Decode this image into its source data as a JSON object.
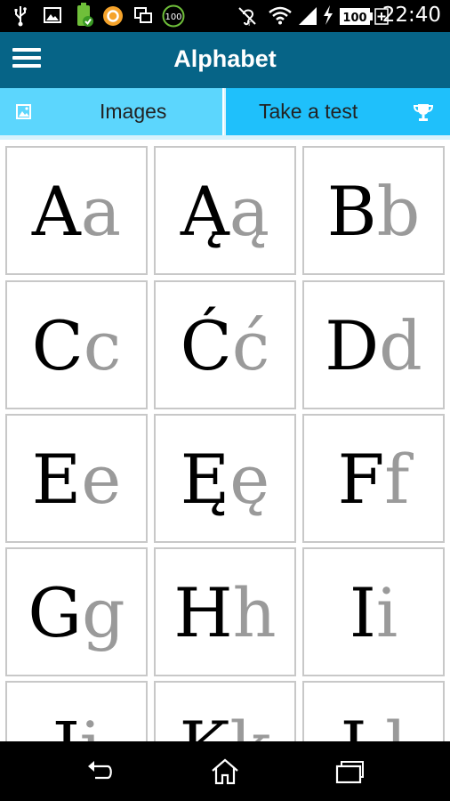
{
  "status_bar": {
    "time": "22:40",
    "battery_level": "100",
    "notification_badge": "100",
    "icons": [
      "usb-icon",
      "image-icon",
      "battery-app-icon",
      "orange-app-icon",
      "multiwindow-icon",
      "badge-100-icon",
      "hearing-icon",
      "wifi-icon",
      "signal-icon",
      "charging-icon",
      "battery-icon"
    ]
  },
  "app_bar": {
    "title": "Alphabet",
    "menu_icon": "hamburger-menu-icon"
  },
  "tabs": [
    {
      "label": "Images",
      "icon": "image-icon",
      "selected": true
    },
    {
      "label": "Take a test",
      "icon": "trophy-icon",
      "selected": false
    }
  ],
  "letters": [
    {
      "upper": "A",
      "lower": "a"
    },
    {
      "upper": "Ą",
      "lower": "ą"
    },
    {
      "upper": "B",
      "lower": "b"
    },
    {
      "upper": "C",
      "lower": "c"
    },
    {
      "upper": "Ć",
      "lower": "ć"
    },
    {
      "upper": "D",
      "lower": "d"
    },
    {
      "upper": "E",
      "lower": "e"
    },
    {
      "upper": "Ę",
      "lower": "ę"
    },
    {
      "upper": "F",
      "lower": "f"
    },
    {
      "upper": "G",
      "lower": "g"
    },
    {
      "upper": "H",
      "lower": "h"
    },
    {
      "upper": "I",
      "lower": "i"
    },
    {
      "upper": "J",
      "lower": "j"
    },
    {
      "upper": "K",
      "lower": "k"
    },
    {
      "upper": "L",
      "lower": "l"
    }
  ],
  "nav_bar": {
    "buttons": [
      "back-icon",
      "home-icon",
      "recent-apps-icon"
    ]
  },
  "colors": {
    "app_bar": "#066487",
    "tab_selected": "#5cd6fd",
    "tab_unselected": "#1fc0fb",
    "upper_letter": "#000000",
    "lower_letter": "#9a9a9a"
  }
}
